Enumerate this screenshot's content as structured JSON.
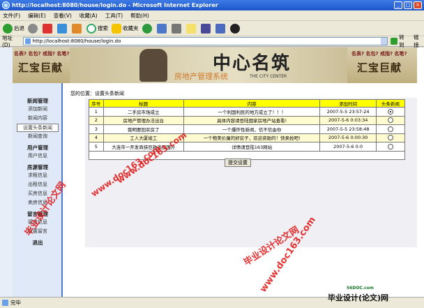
{
  "window": {
    "title": "http://localhost:8080/house/login.do - Microsoft Internet Explorer",
    "min": "_",
    "max": "□",
    "close": "×"
  },
  "menu": [
    "文件(F)",
    "编辑(E)",
    "查看(V)",
    "收藏(A)",
    "工具(T)",
    "帮助(H)"
  ],
  "toolbar": {
    "back": "后退",
    "search": "搜索",
    "favorites": "收藏夹"
  },
  "address": {
    "label": "地址(D)",
    "url": "http://localhost:8080/house/login.do",
    "go": "转到",
    "links": "链接"
  },
  "banner": {
    "left_slogan": "名表? 名包? 戒指? 名笔?",
    "left_big": "汇宝巨献",
    "logo": "中心名筑",
    "subtitle": "房地产管理系统",
    "city": "THE CITY CENTER",
    "right_slogan": "名表? 名包? 戒指? 名笔?",
    "right_big": "汇宝巨献"
  },
  "sidebar": {
    "sections": [
      {
        "title": "新闻管理",
        "items": [
          "添加新闻",
          "新闻内容",
          "设置头条新闻",
          "新闻查询"
        ]
      },
      {
        "title": "用户管理",
        "items": [
          "用户信息"
        ]
      },
      {
        "title": "房源管理",
        "items": [
          "求租信息",
          "出租信息",
          "买房信息",
          "卖房信息"
        ]
      },
      {
        "title": "留言管理",
        "items": [
          "留言信息",
          "设置留言"
        ]
      }
    ],
    "logout": "退出",
    "selected": "设置头条新闻"
  },
  "main": {
    "location": "您的位置：设置头条新闻",
    "columns": [
      "序号",
      "标题",
      "内容",
      "添加时间",
      "头条新闻"
    ],
    "rows": [
      {
        "no": "1",
        "title": "二手房市场成立",
        "content": "一个利国利民的地方成立了！！！",
        "time": "2007-5-5 23:57:24",
        "headline": true
      },
      {
        "no": "2",
        "title": "房地产管理办法出台",
        "content": "具体内容请登陆国家房地产站查看!",
        "time": "2007-5-6 0:03:34",
        "headline": false
      },
      {
        "no": "3",
        "title": "我明要回买房了",
        "content": "一个爆炸性新闻，信不信由你",
        "time": "2007-5-5 23:58:48",
        "headline": false
      },
      {
        "no": "4",
        "title": "工人大厦竣工",
        "content": "一个物美价廉的好房子，欢迎资助的！快来抢吧!",
        "time": "2007-5-6 0:00:30",
        "headline": false
      },
      {
        "no": "5",
        "title": "大连市一开发商挟巨款逃到国外",
        "content": "详情请登陆163网站",
        "time": "2007-5-6 0:0",
        "headline": false
      }
    ],
    "submit": "提交设置"
  },
  "status": "完毕",
  "watermarks": {
    "w1": "www.doc163.com",
    "w2": "www.doc163.com",
    "w3": "毕业设计论文网",
    "w4": "www.doc163.com",
    "w5": "毕业设计论文网"
  },
  "corner": {
    "site": "56DOC.com",
    "brand": "毕业设计(论文)网"
  }
}
